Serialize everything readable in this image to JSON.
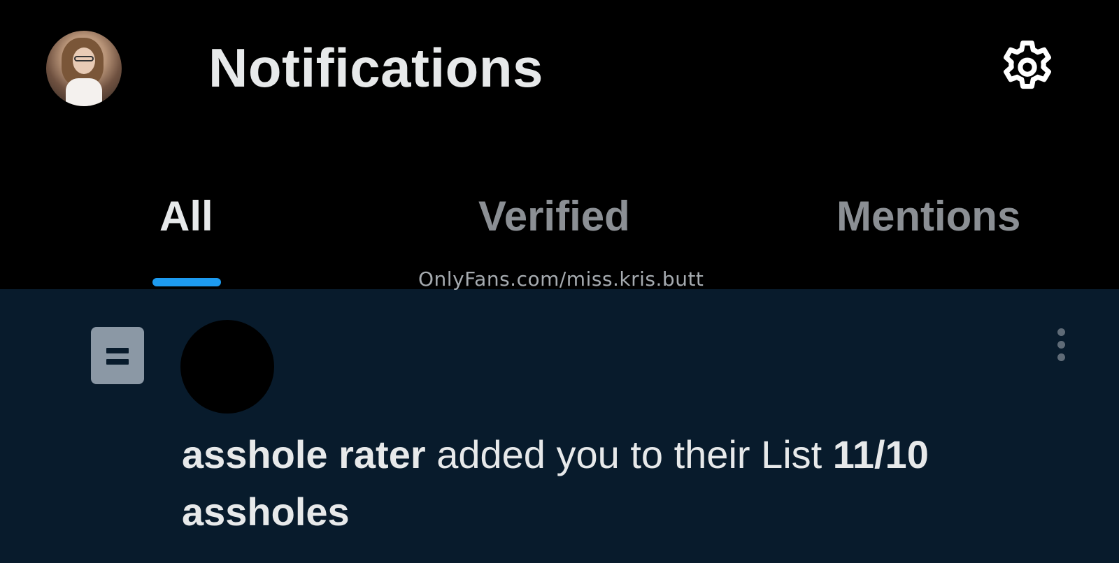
{
  "header": {
    "title": "Notifications",
    "avatar_icon": "profile-avatar",
    "settings_icon": "gear-icon"
  },
  "tabs": [
    {
      "label": "All",
      "active": true
    },
    {
      "label": "Verified",
      "active": false
    },
    {
      "label": "Mentions",
      "active": false
    }
  ],
  "watermark": "OnlyFans.com/miss.kris.butt",
  "notification": {
    "type_icon": "list-icon",
    "actor": "asshole rater",
    "action": "added you to their List",
    "list_name": "11/10 assholes",
    "more_icon": "more-vertical-icon"
  },
  "colors": {
    "background": "#000000",
    "item_background": "#081b2c",
    "accent": "#1d9bf0",
    "text_primary": "#e7e9ea",
    "text_secondary": "#8b8f94"
  }
}
